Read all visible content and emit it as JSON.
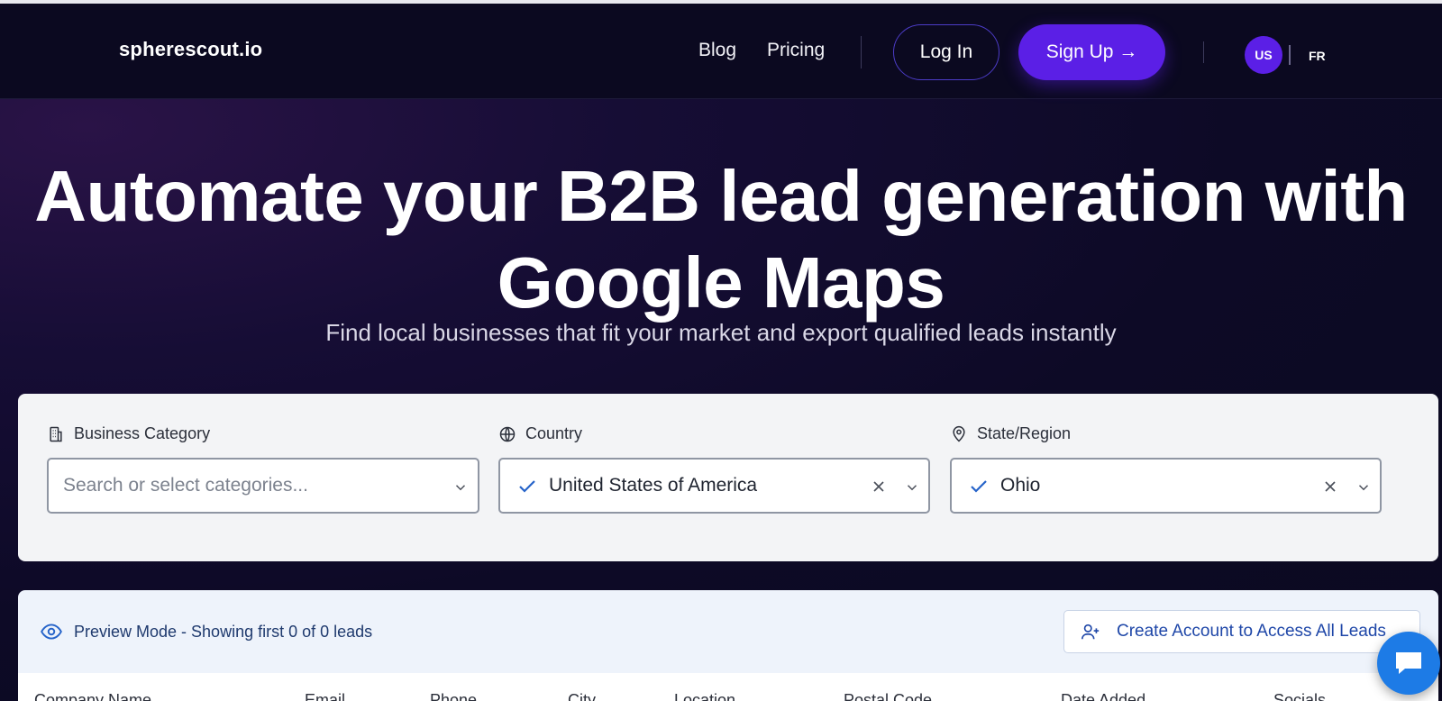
{
  "header": {
    "logo": "spherescout.io",
    "nav": {
      "blog": "Blog",
      "pricing": "Pricing"
    },
    "login_label": "Log In",
    "signup_label": "Sign Up →",
    "languages": {
      "us": "US",
      "fr": "FR"
    }
  },
  "hero": {
    "title_line1": "Automate your B2B lead generation with",
    "title_line2": "Google Maps",
    "subtitle": "Find local businesses that fit your market and export qualified leads instantly"
  },
  "filters": {
    "category": {
      "label": "Business Category",
      "placeholder": "Search or select categories...",
      "icon": "building-icon"
    },
    "country": {
      "label": "Country",
      "value": "United States of America",
      "icon": "globe-icon"
    },
    "state": {
      "label": "State/Region",
      "value": "Ohio",
      "icon": "map-pin-icon"
    }
  },
  "results": {
    "preview_text": "Preview Mode - Showing first 0 of 0 leads",
    "create_account_label": "Create Account to Access All Leads",
    "columns": [
      "Company Name",
      "Email",
      "Phone",
      "City",
      "Location",
      "Postal Code",
      "Date Added",
      "Socials"
    ]
  },
  "colors": {
    "accent": "#5b1fe6",
    "background": "#0b0920",
    "chat": "#1d7be6",
    "link": "#1f47a8"
  }
}
